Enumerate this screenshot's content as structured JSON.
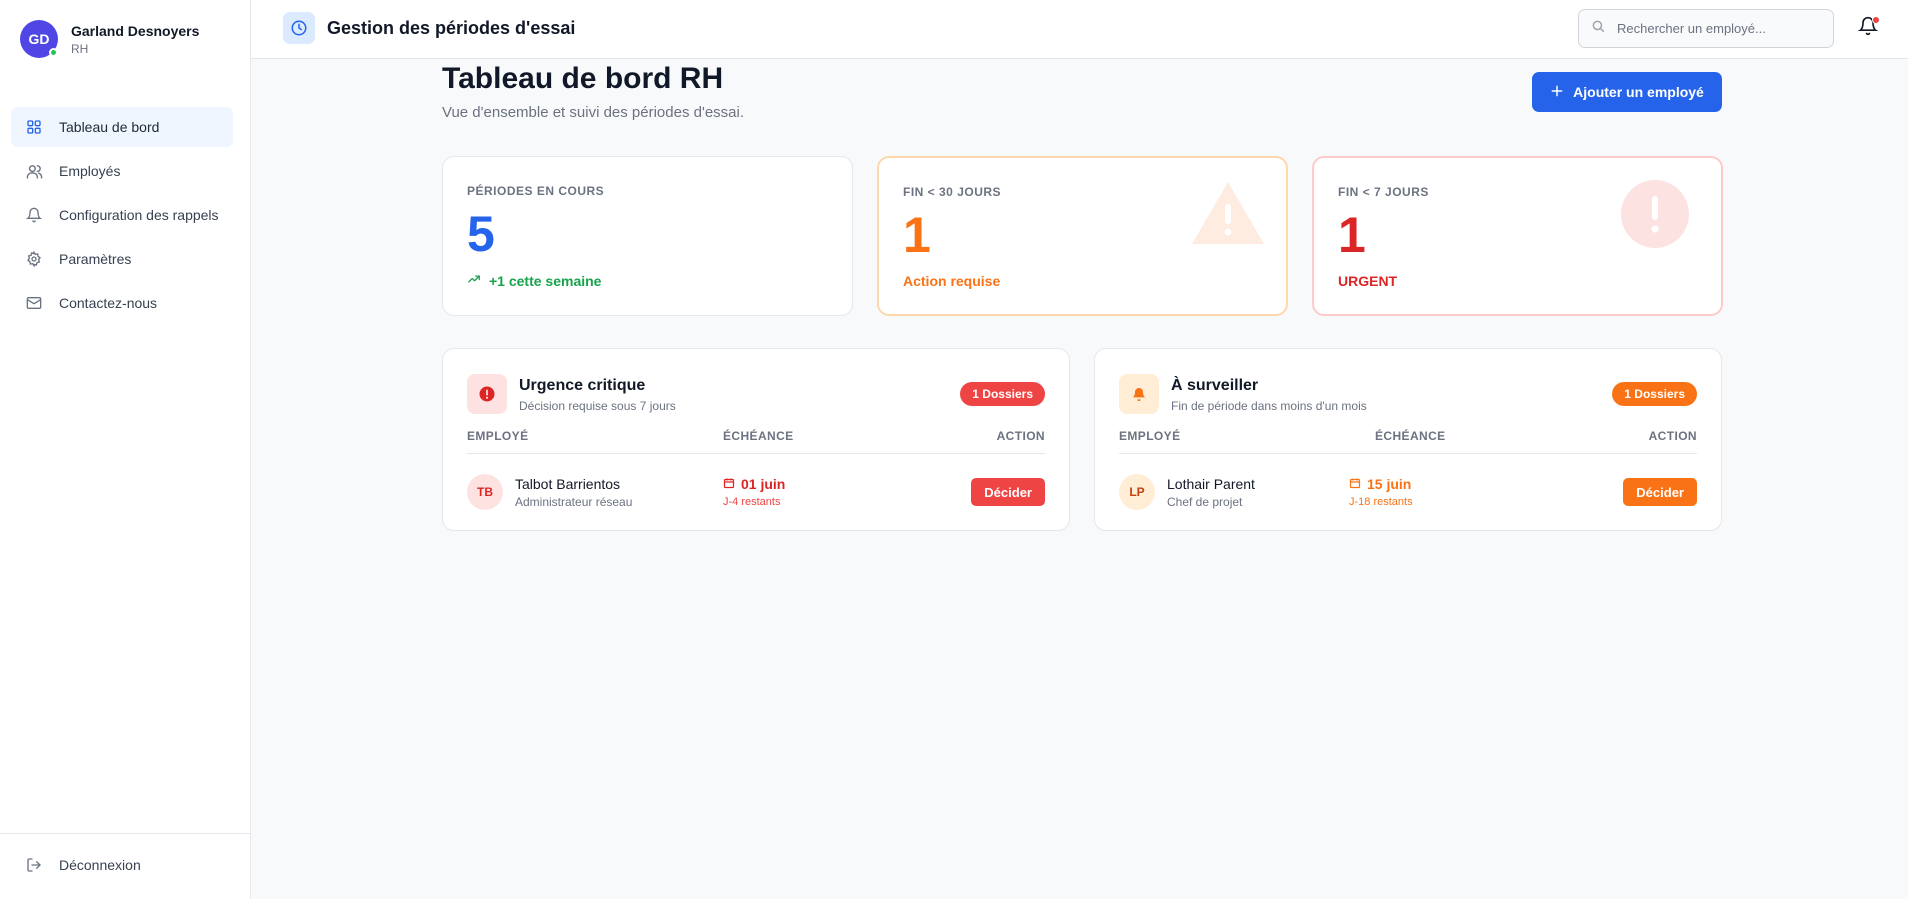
{
  "user": {
    "initials": "GD",
    "name": "Garland Desnoyers",
    "role": "RH"
  },
  "sidebar": {
    "items": [
      {
        "label": "Tableau de bord",
        "icon": "dashboard-icon",
        "active": true
      },
      {
        "label": "Employés",
        "icon": "users-icon"
      },
      {
        "label": "Configuration des rappels",
        "icon": "bell-icon"
      },
      {
        "label": "Paramètres",
        "icon": "gear-icon"
      },
      {
        "label": "Contactez-nous",
        "icon": "mail-icon"
      }
    ],
    "logout_label": "Déconnexion"
  },
  "header": {
    "title": "Gestion des périodes d'essai",
    "search_placeholder": "Rechercher un employé..."
  },
  "main": {
    "title": "Tableau de bord RH",
    "subtitle": "Vue d'ensemble et suivi des périodes d'essai.",
    "add_button": "Ajouter un employé"
  },
  "stats": [
    {
      "label": "PÉRIODES EN COURS",
      "value": "5",
      "note": "+1 cette semaine",
      "color": "#2563eb",
      "note_color": "#16a34a"
    },
    {
      "label": "FIN < 30 JOURS",
      "value": "1",
      "note": "Action requise",
      "color": "#f97316",
      "note_color": "#f97316"
    },
    {
      "label": "FIN < 7 JOURS",
      "value": "1",
      "note": "URGENT",
      "color": "#dc2626",
      "note_color": "#dc2626"
    }
  ],
  "panels": [
    {
      "title": "Urgence critique",
      "subtitle": "Décision requise sous 7 jours",
      "badge": "1 Dossiers",
      "columns": [
        "EMPLOYÉ",
        "ÉCHÉANCE",
        "ACTION"
      ],
      "rows": [
        {
          "initials": "TB",
          "name": "Talbot Barrientos",
          "role": "Administrateur réseau",
          "date": "01 juin",
          "remaining": "J-4 restants",
          "action": "Décider"
        }
      ],
      "accent": "#ef4444"
    },
    {
      "title": "À surveiller",
      "subtitle": "Fin de période dans moins d'un mois",
      "badge": "1 Dossiers",
      "columns": [
        "EMPLOYÉ",
        "ÉCHÉANCE",
        "ACTION"
      ],
      "rows": [
        {
          "initials": "LP",
          "name": "Lothair Parent",
          "role": "Chef de projet",
          "date": "15 juin",
          "remaining": "J-18 restants",
          "action": "Décider"
        }
      ],
      "accent": "#f97316"
    }
  ]
}
